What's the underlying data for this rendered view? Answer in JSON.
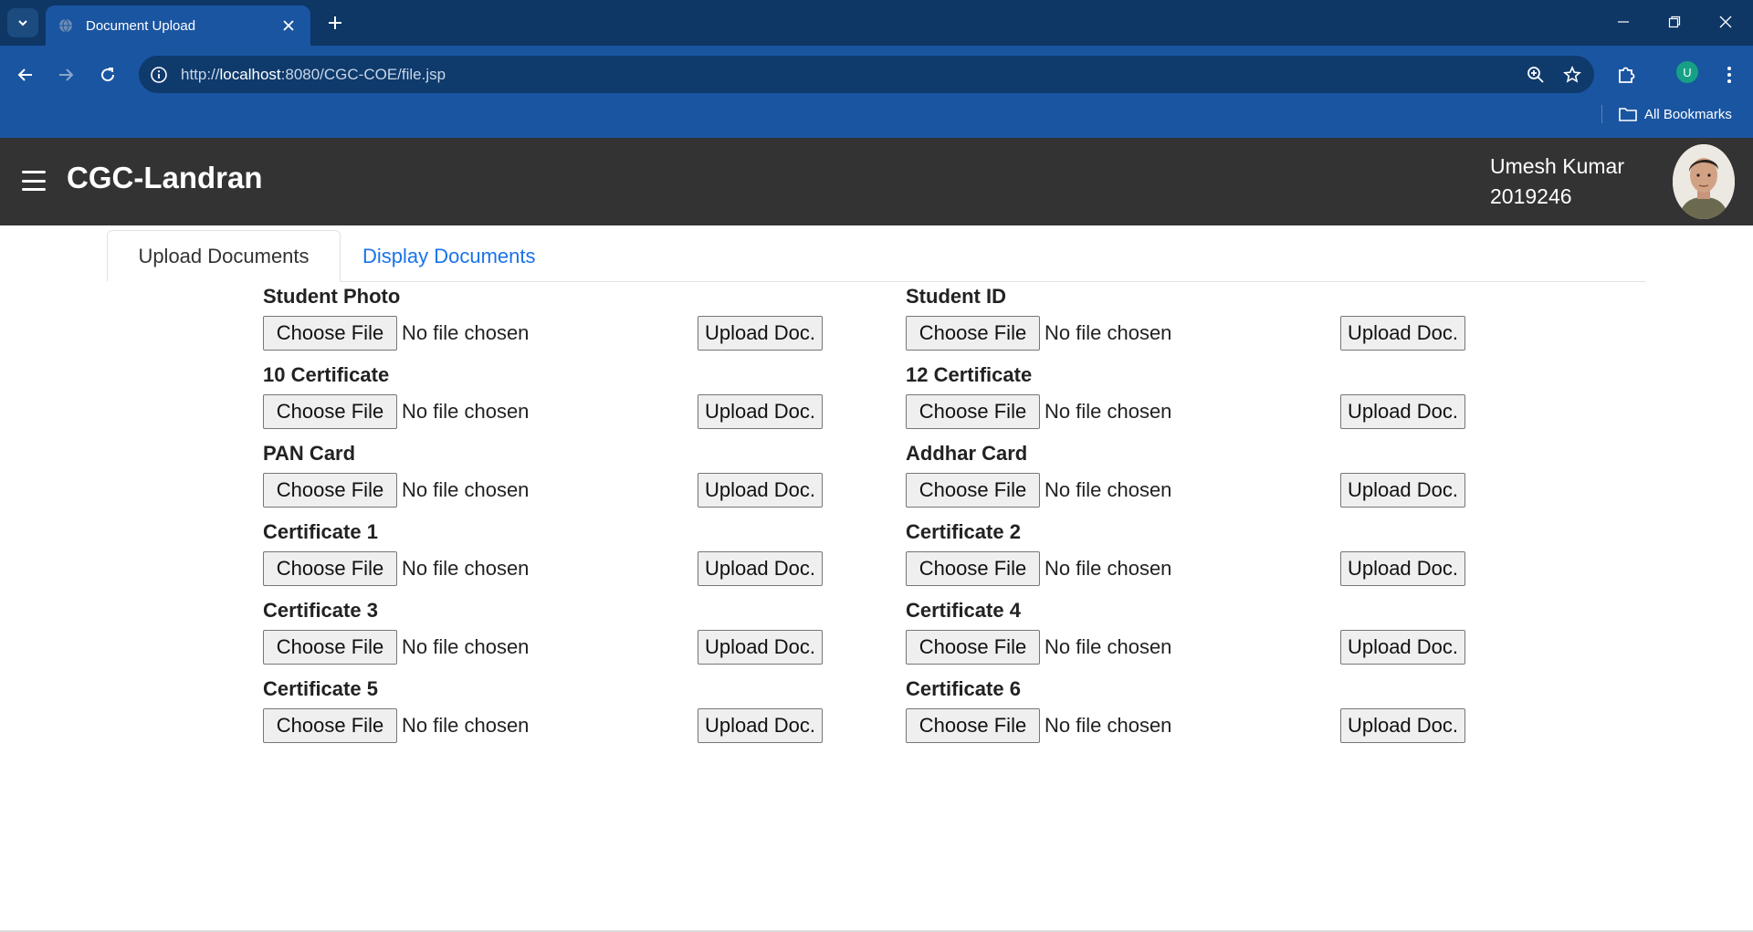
{
  "browser": {
    "tab_title": "Document Upload",
    "url_prefix": "http://",
    "url_host": "localhost",
    "url_rest": ":8080/CGC-COE/file.jsp",
    "profile_initial": "U",
    "bookmarks_label": "All Bookmarks",
    "accent": "#1a55a1"
  },
  "header": {
    "brand": "CGC-Landran",
    "user_name": "Umesh Kumar",
    "user_id": "2019246"
  },
  "tabs": {
    "upload": "Upload Documents",
    "display": "Display Documents"
  },
  "documents": [
    {
      "label": "Student Photo",
      "choose": "Choose File",
      "status": "No file chosen",
      "upload": "Upload Doc."
    },
    {
      "label": "Student ID",
      "choose": "Choose File",
      "status": "No file chosen",
      "upload": "Upload Doc."
    },
    {
      "label": "10 Certificate",
      "choose": "Choose File",
      "status": "No file chosen",
      "upload": "Upload Doc."
    },
    {
      "label": "12 Certificate",
      "choose": "Choose File",
      "status": "No file chosen",
      "upload": "Upload Doc."
    },
    {
      "label": "PAN Card",
      "choose": "Choose File",
      "status": "No file chosen",
      "upload": "Upload Doc."
    },
    {
      "label": "Addhar Card",
      "choose": "Choose File",
      "status": "No file chosen",
      "upload": "Upload Doc."
    },
    {
      "label": "Certificate 1",
      "choose": "Choose File",
      "status": "No file chosen",
      "upload": "Upload Doc."
    },
    {
      "label": "Certificate 2",
      "choose": "Choose File",
      "status": "No file chosen",
      "upload": "Upload Doc."
    },
    {
      "label": "Certificate 3",
      "choose": "Choose File",
      "status": "No file chosen",
      "upload": "Upload Doc."
    },
    {
      "label": "Certificate 4",
      "choose": "Choose File",
      "status": "No file chosen",
      "upload": "Upload Doc."
    },
    {
      "label": "Certificate 5",
      "choose": "Choose File",
      "status": "No file chosen",
      "upload": "Upload Doc."
    },
    {
      "label": "Certificate 6",
      "choose": "Choose File",
      "status": "No file chosen",
      "upload": "Upload Doc."
    }
  ]
}
